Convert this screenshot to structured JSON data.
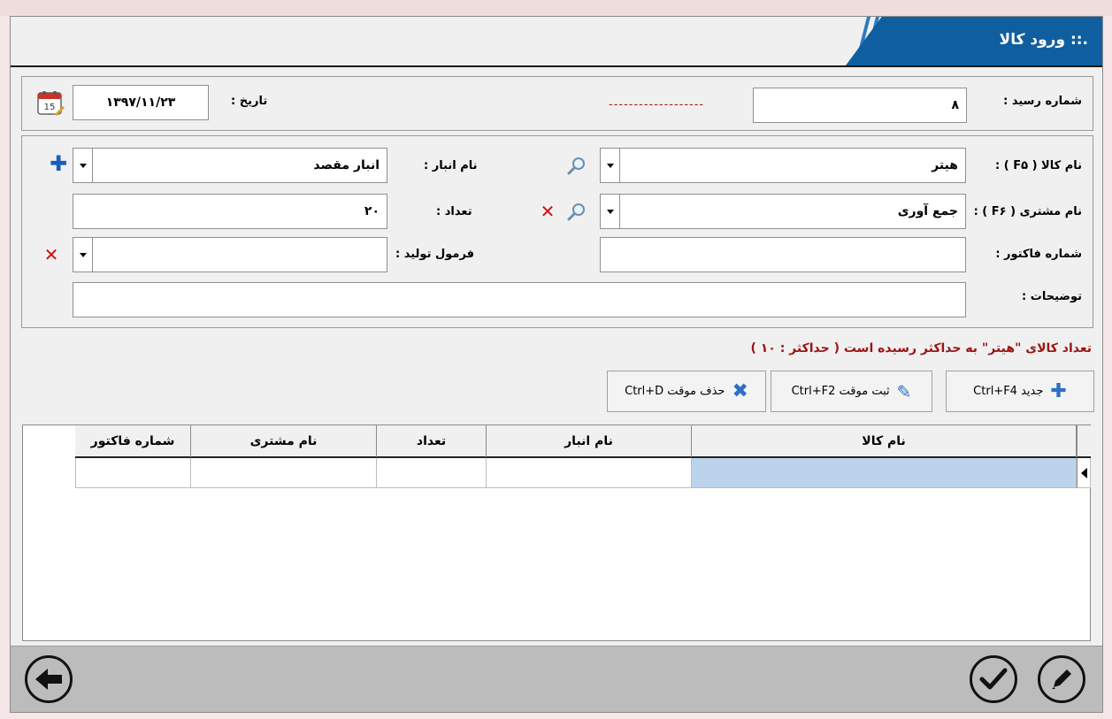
{
  "window": {
    "title": ".:: ورود کالا"
  },
  "header": {
    "receipt_label": "شماره رسید :",
    "receipt_value": "۸",
    "receipt_dashes": "-------------------",
    "date_label": "تاریخ :",
    "date_value": "۱۳۹۷/۱۱/۲۳",
    "calendar_number": "15"
  },
  "form": {
    "product_label": "نام کالا ( F۵ ) :",
    "product_value": "هیتر",
    "warehouse_label": "نام انبار :",
    "warehouse_value": "انبار مقصد",
    "customer_label": "نام مشتری ( F۶ ) :",
    "customer_value": "جمع آوری",
    "quantity_label": "تعداد :",
    "quantity_value": "۲۰",
    "invoice_label": "شماره فاکتور :",
    "invoice_value": "",
    "formula_label": "فرمول تولید :",
    "formula_value": "",
    "notes_label": "توضیحات :",
    "notes_value": ""
  },
  "warning_text": "تعداد کالای  \"هیتر\"  به حداکثر رسیده است  ( حداکثر : ۱۰ )",
  "toolbar": {
    "new_label": "جدید Ctrl+F4",
    "temp_save_label": "ثبت موقت  Ctrl+F2",
    "temp_delete_label": "حذف موقت Ctrl+D"
  },
  "grid": {
    "columns": [
      "نام کالا",
      "نام انبار",
      "تعداد",
      "نام مشتری",
      "شماره فاکتور"
    ]
  },
  "colors": {
    "accent": "#0f5fa0",
    "selected_cell": "#bcd3ec",
    "warning": "#9a1515"
  }
}
